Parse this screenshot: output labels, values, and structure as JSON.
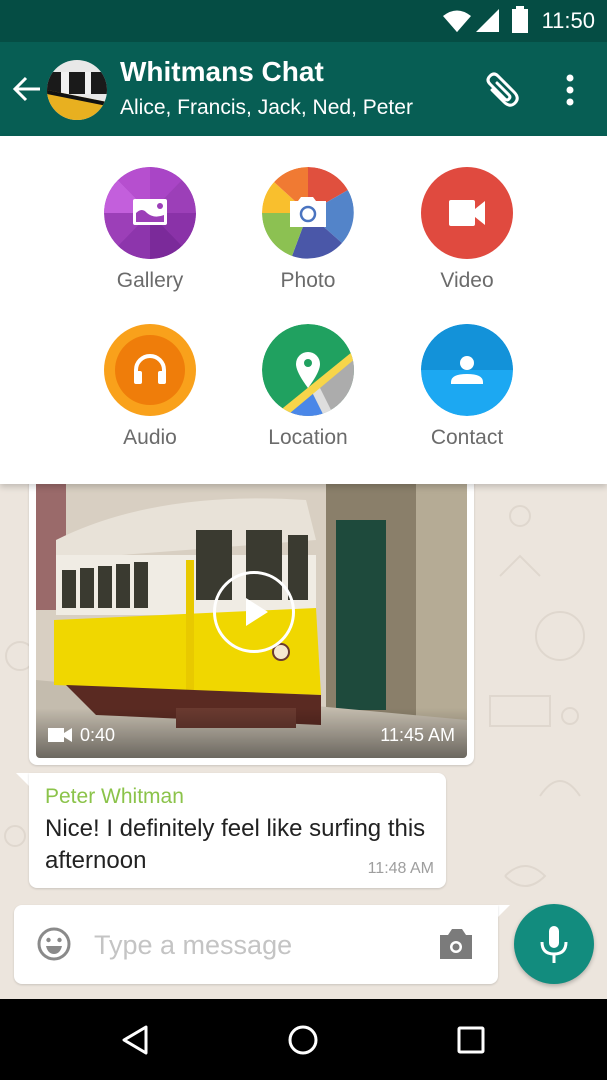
{
  "status_bar": {
    "time": "11:50",
    "icons": [
      "wifi-icon",
      "cell-signal-icon",
      "battery-icon"
    ]
  },
  "app_bar": {
    "title": "Whitmans Chat",
    "subtitle": "Alice, Francis, Jack, Ned, Peter",
    "back_icon": "arrow-left-icon",
    "attach_icon": "paperclip-icon",
    "menu_icon": "more-vert-icon"
  },
  "attach_panel": {
    "items": [
      {
        "label": "Gallery",
        "icon": "image-icon",
        "color": "#9c3fb8"
      },
      {
        "label": "Photo",
        "icon": "camera-icon",
        "color": "#4a8fd4"
      },
      {
        "label": "Video",
        "icon": "videocam-icon",
        "color": "#e04a3f"
      },
      {
        "label": "Audio",
        "icon": "headphones-icon",
        "color": "#f57c00"
      },
      {
        "label": "Location",
        "icon": "location-pin-icon",
        "color": "#20a160"
      },
      {
        "label": "Contact",
        "icon": "person-icon",
        "color": "#1a9be8"
      }
    ]
  },
  "messages": [
    {
      "type": "video",
      "duration": "0:40",
      "time": "11:45 AM"
    },
    {
      "type": "text",
      "sender": "Peter Whitman",
      "text": "Nice! I definitely feel like surfing this afternoon",
      "time": "11:48 AM"
    }
  ],
  "composer": {
    "placeholder": "Type a message",
    "value": ""
  },
  "nav_bar": {
    "icons": [
      "back-triangle-icon",
      "home-circle-icon",
      "recents-square-icon"
    ]
  },
  "colors": {
    "header": "#075e54",
    "status_bar": "#054d44",
    "accent": "#128c7e",
    "sender_name": "#8bc34a",
    "wallpaper": "#ece5dd"
  }
}
